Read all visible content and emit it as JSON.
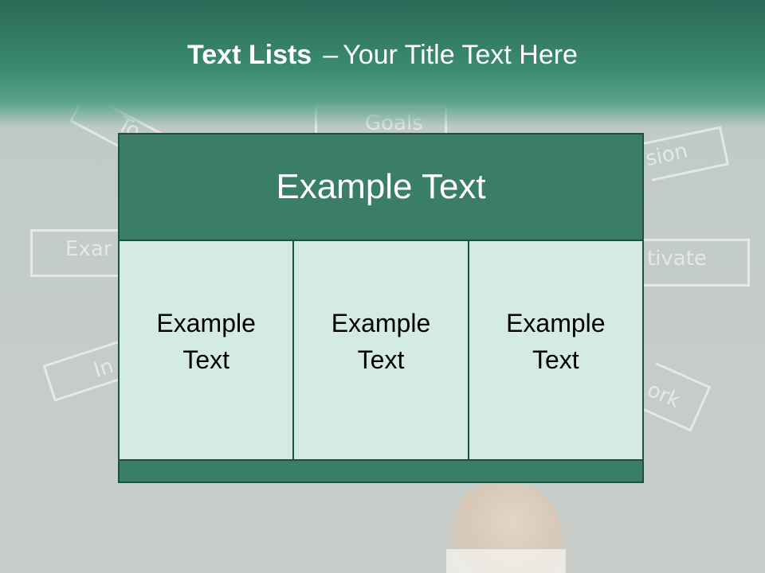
{
  "slide": {
    "title_bold": "Text Lists",
    "title_dash": "–",
    "title_rest": "Your Title Text Here"
  },
  "background_sketch": {
    "words": [
      "Goals",
      "sion",
      "tivate",
      "ork",
      "Exar",
      "In",
      "To"
    ]
  },
  "table": {
    "header": "Example Text",
    "cells": [
      {
        "line1": "Example",
        "line2": "Text"
      },
      {
        "line1": "Example",
        "line2": "Text"
      },
      {
        "line1": "Example",
        "line2": "Text"
      }
    ]
  },
  "colors": {
    "header_band": "#3b8b72",
    "table_header": "#3a7e69",
    "table_cell": "#d4ebe4",
    "table_border": "#1f4f42"
  }
}
